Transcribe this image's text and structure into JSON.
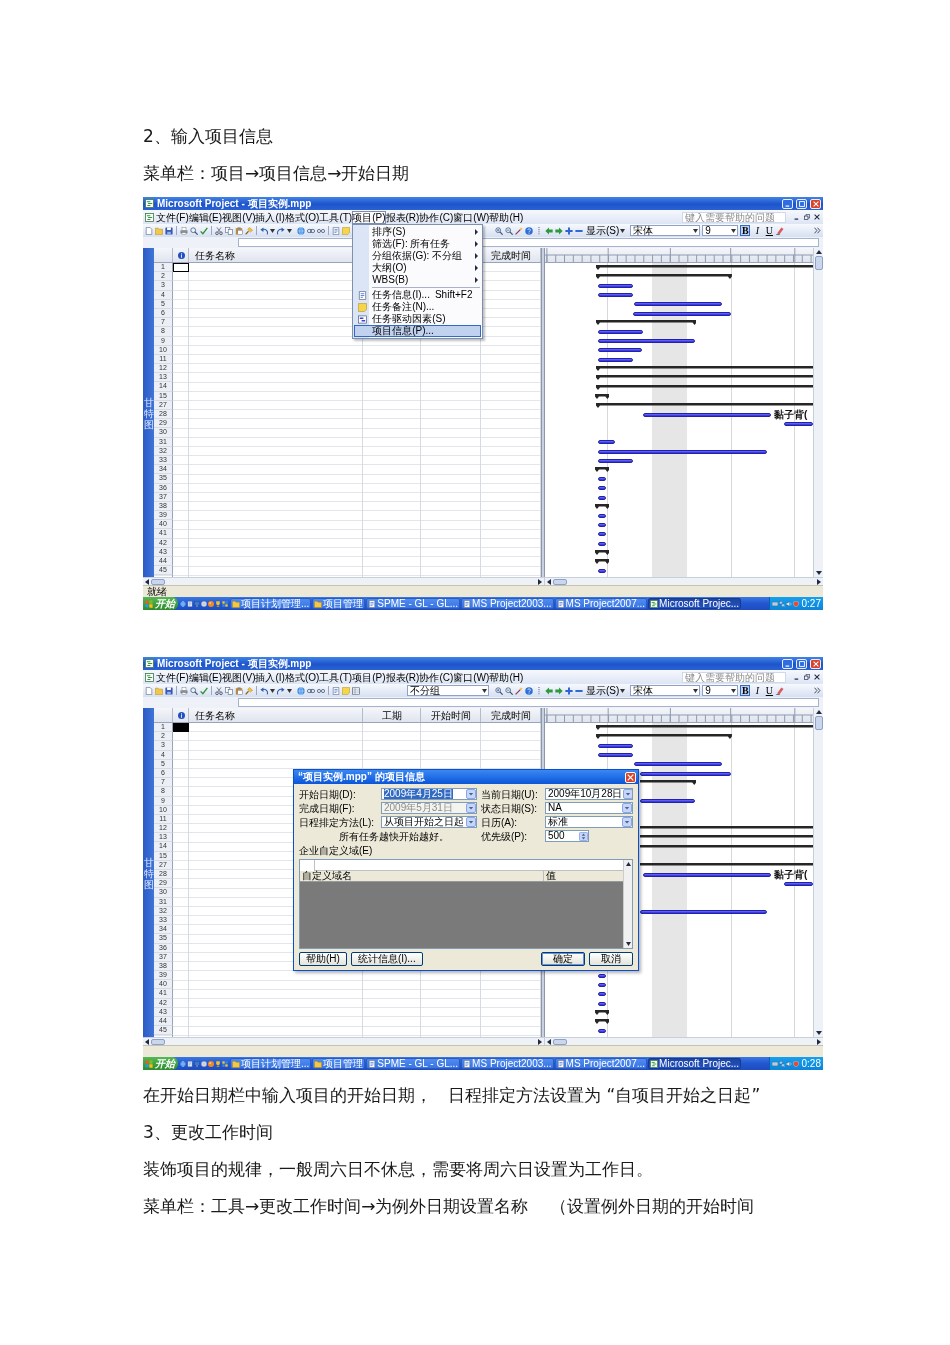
{
  "blocks": [
    {
      "kind": "heading",
      "text": "2、输入项目信息"
    },
    {
      "kind": "menu_path",
      "text": "菜单栏：项目→项目信息→开始日期"
    },
    {
      "kind": "screenshot",
      "window": {
        "title": "Microsoft Project - 项目实例.mpp",
        "menu_bar": [
          {
            "label": "文件(F)",
            "selected": false
          },
          {
            "label": "编辑(E)",
            "selected": false
          },
          {
            "label": "视图(V)",
            "selected": false
          },
          {
            "label": "插入(I)",
            "selected": false
          },
          {
            "label": "格式(O)",
            "selected": false
          },
          {
            "label": "工具(T)",
            "selected": false
          },
          {
            "label": "项目(P)",
            "selected": true
          },
          {
            "label": "报表(R)",
            "selected": false
          },
          {
            "label": "协作(C)",
            "selected": false
          },
          {
            "label": "窗口(W)",
            "selected": false
          },
          {
            "label": "帮助(H)",
            "selected": false
          }
        ],
        "help_box": {
          "placeholder": "键入需要帮助的问题"
        },
        "toolbar": {
          "view_menu": "显示(S)",
          "font": "宋体",
          "font_size": "9",
          "format_buttons": [
            {
              "kind": "bold",
              "label": "B",
              "pressed": true
            },
            {
              "kind": "italic",
              "label": "I",
              "pressed": false
            },
            {
              "kind": "underline",
              "label": "U",
              "pressed": false
            }
          ]
        },
        "view_bar": "甘特图",
        "table": {
          "columns": [
            {
              "kind": "name",
              "label": "任务名称"
            },
            {
              "kind": "finish",
              "label": "完成时间"
            }
          ],
          "row_numbers": [
            "1",
            "2",
            "3",
            "4",
            "5",
            "6",
            "7",
            "8",
            "9",
            "10",
            "11",
            "12",
            "13",
            "14",
            "15",
            "27",
            "28",
            "29",
            "30",
            "31",
            "32",
            "33",
            "34",
            "35",
            "36",
            "37",
            "38",
            "39",
            "40",
            "41",
            "42",
            "43",
            "44",
            "45"
          ],
          "active_cell_filled": false
        },
        "gantt": {
          "bar_label": "黏子背("
        },
        "status_bar": "就绪",
        "taskbar": {
          "start": "开始",
          "items": [
            {
              "kind": "folder",
              "label": "项目计划管理...",
              "selected": false
            },
            {
              "kind": "folder",
              "label": "项目管理",
              "selected": false
            },
            {
              "kind": "document",
              "label": "SPME - GL - GL...",
              "selected": false
            },
            {
              "kind": "document",
              "label": "MS Project2003...",
              "selected": false
            },
            {
              "kind": "document",
              "label": "MS Project2007...",
              "selected": false
            },
            {
              "kind": "project",
              "label": "Microsoft Projec...",
              "selected": true
            }
          ],
          "clock": "0:27"
        },
        "menu": {
          "items": [
            {
              "label": "排序(S)",
              "has_submenu": true,
              "has_icon": false,
              "separator_before": false,
              "selected": false
            },
            {
              "label": "筛选(F): 所有任务",
              "has_submenu": true,
              "has_icon": false,
              "separator_before": false,
              "selected": false
            },
            {
              "label": "分组依据(G): 不分组",
              "has_submenu": true,
              "has_icon": false,
              "separator_before": false,
              "selected": false
            },
            {
              "label": "大纲(O)",
              "has_submenu": true,
              "has_icon": false,
              "separator_before": false,
              "selected": false
            },
            {
              "label": "WBS(B)",
              "has_submenu": true,
              "has_icon": false,
              "separator_before": false,
              "selected": false
            },
            {
              "label": "任务信息(I)...",
              "shortcut": "Shift+F2",
              "has_submenu": false,
              "has_icon": true,
              "separator_before": true,
              "selected": false
            },
            {
              "label": "任务备注(N)...",
              "has_submenu": false,
              "has_icon": true,
              "separator_before": false,
              "selected": false
            },
            {
              "label": "任务驱动因素(S)",
              "has_submenu": false,
              "has_icon": true,
              "separator_before": false,
              "selected": false
            },
            {
              "label": "项目信息(P)...",
              "has_submenu": false,
              "has_icon": false,
              "separator_before": false,
              "selected": true
            }
          ]
        }
      }
    },
    {
      "kind": "screenshot",
      "window": {
        "title": "Microsoft Project - 项目实例.mpp",
        "menu_bar": [
          {
            "label": "文件(F)",
            "selected": false
          },
          {
            "label": "编辑(E)",
            "selected": false
          },
          {
            "label": "视图(V)",
            "selected": false
          },
          {
            "label": "插入(I)",
            "selected": false
          },
          {
            "label": "格式(O)",
            "selected": false
          },
          {
            "label": "工具(T)",
            "selected": false
          },
          {
            "label": "项目(P)",
            "selected": false
          },
          {
            "label": "报表(R)",
            "selected": false
          },
          {
            "label": "协作(C)",
            "selected": false
          },
          {
            "label": "窗口(W)",
            "selected": false
          },
          {
            "label": "帮助(H)",
            "selected": false
          }
        ],
        "help_box": {
          "placeholder": "键入需要帮助的问题"
        },
        "toolbar": {
          "group_dropdown": "不分组",
          "view_menu": "显示(S)",
          "font": "宋体",
          "font_size": "9",
          "format_buttons": [
            {
              "kind": "bold",
              "label": "B",
              "pressed": true
            },
            {
              "kind": "italic",
              "label": "I",
              "pressed": false
            },
            {
              "kind": "underline",
              "label": "U",
              "pressed": false
            }
          ]
        },
        "view_bar": "甘特图",
        "table": {
          "columns": [
            {
              "kind": "name",
              "label": "任务名称"
            },
            {
              "kind": "duration",
              "label": "工期"
            },
            {
              "kind": "start",
              "label": "开始时间"
            },
            {
              "kind": "finish",
              "label": "完成时间"
            }
          ],
          "row_numbers": [
            "1",
            "2",
            "3",
            "4",
            "5",
            "6",
            "7",
            "8",
            "9",
            "10",
            "11",
            "12",
            "13",
            "14",
            "15",
            "27",
            "28",
            "29",
            "30",
            "31",
            "32",
            "33",
            "34",
            "35",
            "36",
            "37",
            "38",
            "39",
            "40",
            "41",
            "42",
            "43",
            "44",
            "45"
          ],
          "active_cell_filled": true
        },
        "gantt": {
          "bar_label": "黏子背("
        },
        "taskbar": {
          "start": "开始",
          "items": [
            {
              "kind": "folder",
              "label": "项目计划管理...",
              "selected": false
            },
            {
              "kind": "folder",
              "label": "项目管理",
              "selected": false
            },
            {
              "kind": "document",
              "label": "SPME - GL - GL...",
              "selected": false
            },
            {
              "kind": "document",
              "label": "MS Project2003...",
              "selected": false
            },
            {
              "kind": "document",
              "label": "MS Project2007...",
              "selected": false
            },
            {
              "kind": "project",
              "label": "Microsoft Projec...",
              "selected": true
            }
          ],
          "clock": "0:28"
        },
        "dialog": {
          "title": "“项目实例.mpp” 的项目信息",
          "left_fields": [
            {
              "label": "开始日期(D):",
              "value": "2009年4月25日",
              "kind": "dropdown",
              "disabled": false,
              "text_selected": true
            },
            {
              "label": "完成日期(F):",
              "value": "2009年5月31日",
              "kind": "dropdown",
              "disabled": true,
              "text_selected": false
            },
            {
              "label": "日程排定方法(L):",
              "value": "从项目开始之日起",
              "kind": "dropdown",
              "disabled": false,
              "text_selected": false
            }
          ],
          "note": "所有任务越快开始越好。",
          "right_fields": [
            {
              "label": "当前日期(U):",
              "value": "2009年10月28日",
              "kind": "dropdown",
              "disabled": false,
              "text_selected": false
            },
            {
              "label": "状态日期(S):",
              "value": "NA",
              "kind": "dropdown",
              "disabled": false,
              "text_selected": false
            },
            {
              "label": "日历(A):",
              "value": "标准",
              "kind": "dropdown",
              "disabled": false,
              "text_selected": false
            },
            {
              "label": "优先级(P):",
              "value": "500",
              "kind": "spin",
              "disabled": false,
              "text_selected": false
            }
          ],
          "section_label": "企业自定义域(E)",
          "grid_columns": [
            "自定义域名",
            "值"
          ],
          "buttons": [
            {
              "label": "帮助(H)",
              "default": false
            },
            {
              "label": "统计信息(I)...",
              "default": false
            },
            {
              "label": "确定",
              "default": true
            },
            {
              "label": "取消",
              "default": false
            }
          ]
        }
      }
    },
    {
      "kind": "paragraph",
      "text": "在开始日期栏中输入项目的开始日期，   日程排定方法设置为 “自项目开始之日起”"
    },
    {
      "kind": "heading",
      "text": "3、更改工作时间"
    },
    {
      "kind": "paragraph",
      "text": "装饰项目的规律，一般周六日不休息，需要将周六日设置为工作日。"
    },
    {
      "kind": "menu_path",
      "text": "菜单栏：工具→更改工作时间→为例外日期设置名称    （设置例外日期的开始时间"
    }
  ]
}
